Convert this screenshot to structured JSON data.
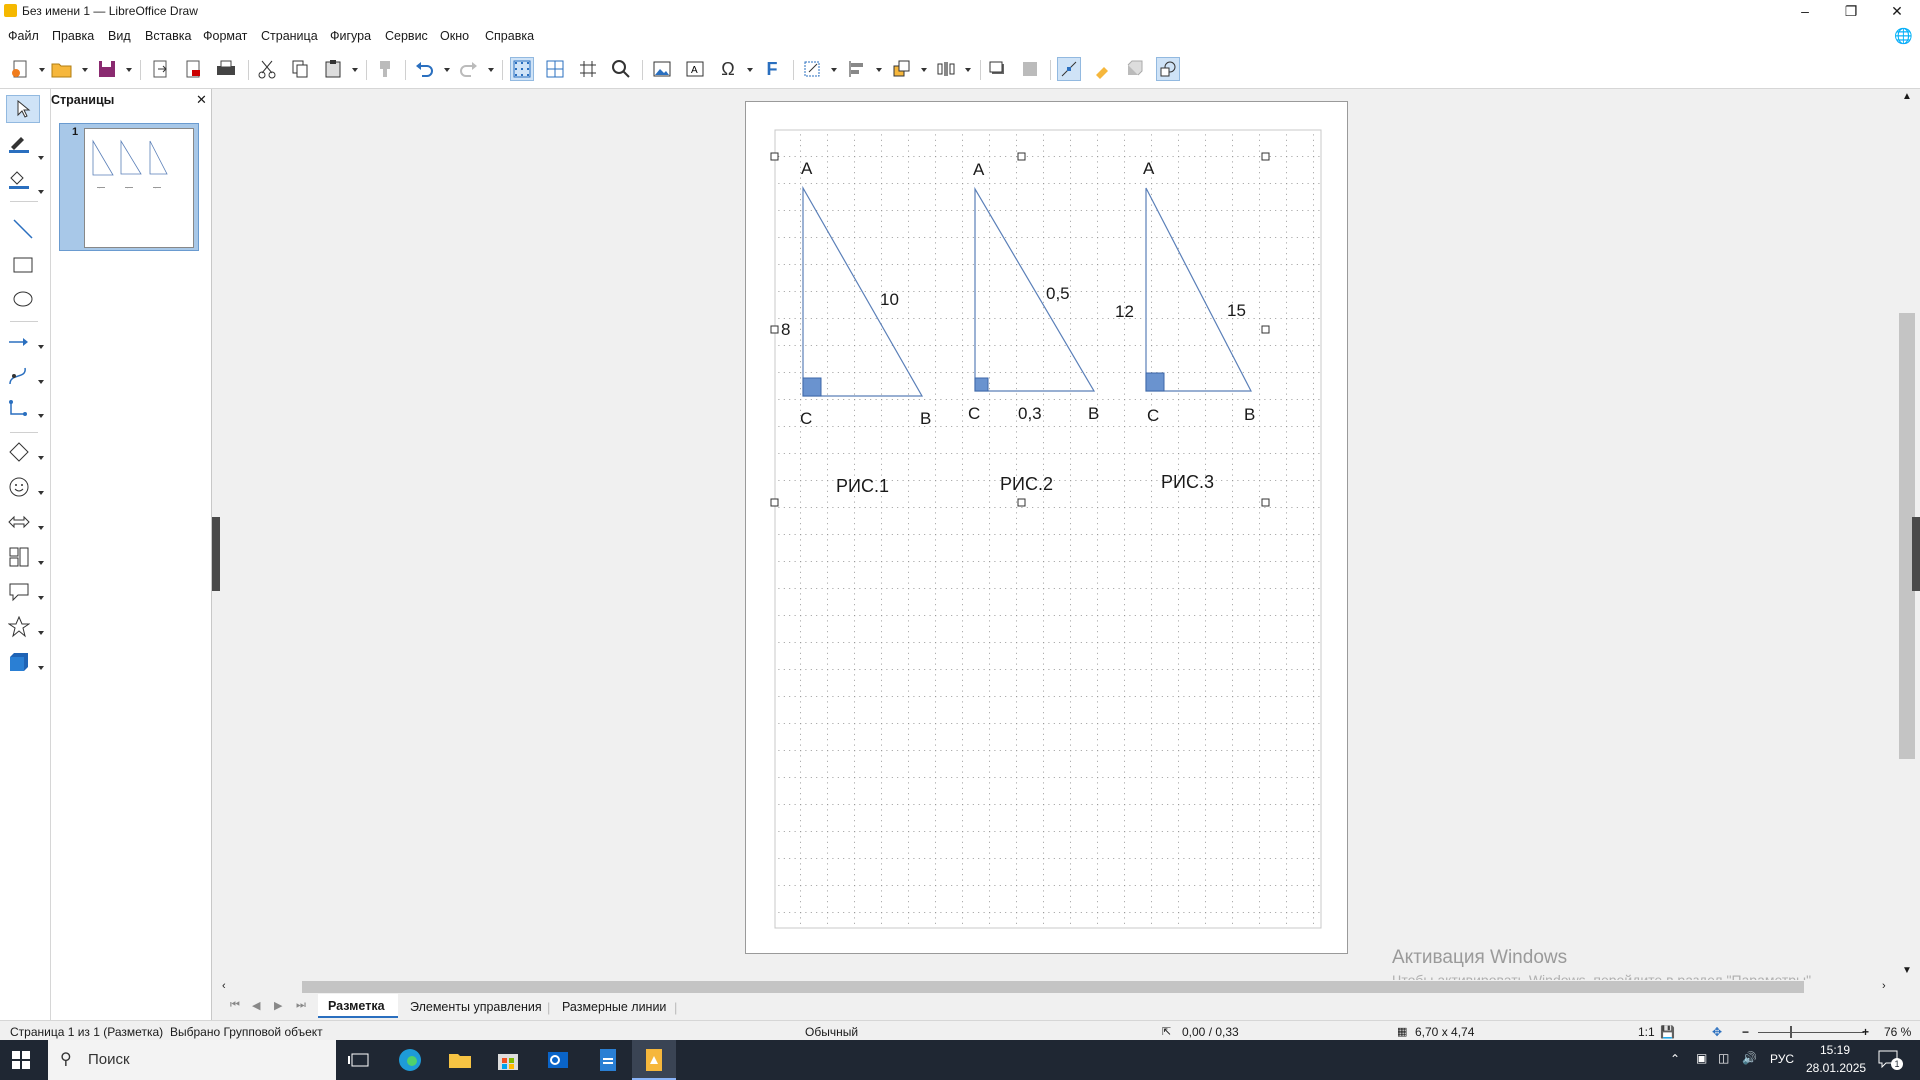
{
  "window": {
    "title": "Без имени 1 — LibreOffice Draw"
  },
  "menu": {
    "items": [
      "Файл",
      "Правка",
      "Вид",
      "Вставка",
      "Формат",
      "Страница",
      "Фигура",
      "Сервис",
      "Окно",
      "Справка"
    ]
  },
  "pages_pane": {
    "title": "Страницы",
    "page_number": "1"
  },
  "drawing": {
    "fig1": {
      "A": "A",
      "B": "B",
      "C": "C",
      "side_ac": "8",
      "side_ab": "10",
      "caption": "РИС.1"
    },
    "fig2": {
      "A": "A",
      "B": "B",
      "C": "C",
      "side_ab": "0,5",
      "side_cb": "0,3",
      "caption": "РИС.2"
    },
    "fig3": {
      "A": "A",
      "B": "B",
      "C": "C",
      "side_ac": "12",
      "side_ab": "15",
      "caption": "РИС.3"
    }
  },
  "tabs": [
    "Разметка",
    "Элементы управления",
    "Размерные линии"
  ],
  "status": {
    "page": "Страница 1 из 1 (Разметка)",
    "selection": "Выбрано Групповой объект",
    "style": "Обычный",
    "position": "0,00 / 0,33",
    "size": "6,70 x 4,74",
    "scale": "1:1",
    "zoom": "76 %"
  },
  "watermark": {
    "line1": "Активация Windows",
    "line2": "Чтобы активировать Windows, перейдите в раздел \"Параметры\"."
  },
  "taskbar": {
    "search_placeholder": "Поиск",
    "lang": "РУС",
    "time": "15:19",
    "date": "28.01.2025",
    "notif_count": "1"
  },
  "colors": {
    "triangle_stroke": "#5a7fb8",
    "right_angle_fill": "#6a93cf",
    "accent": "#cfe3f7"
  }
}
